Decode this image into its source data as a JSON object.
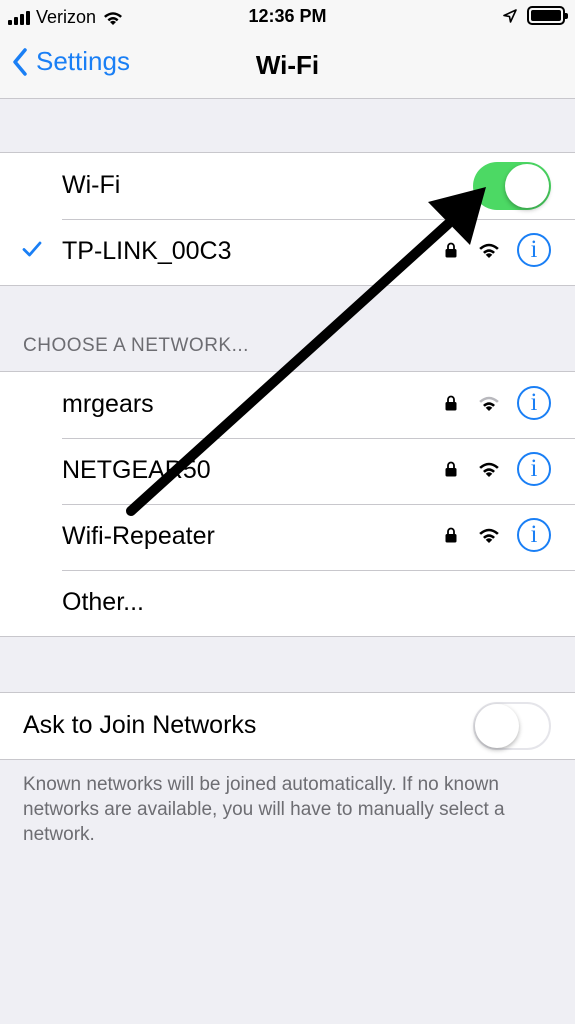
{
  "status_bar": {
    "carrier": "Verizon",
    "time": "12:36 PM"
  },
  "nav": {
    "back_label": "Settings",
    "title": "Wi-Fi"
  },
  "wifi": {
    "label": "Wi-Fi",
    "enabled": true,
    "connected_network": "TP-LINK_00C3"
  },
  "choose_header": "CHOOSE A NETWORK...",
  "networks": [
    {
      "name": "mrgears",
      "secured": true,
      "signal_bars": 2
    },
    {
      "name": "NETGEAR50",
      "secured": true,
      "signal_bars": 3
    },
    {
      "name": "Wifi-Repeater",
      "secured": true,
      "signal_bars": 3
    }
  ],
  "other_label": "Other...",
  "ask_to_join": {
    "label": "Ask to Join Networks",
    "enabled": false
  },
  "footer_note": "Known networks will be joined automatically. If no known networks are available, you will have to manually select a network.",
  "colors": {
    "accent": "#1a7ff5",
    "toggle_on": "#4cd964",
    "background": "#efeff4"
  }
}
